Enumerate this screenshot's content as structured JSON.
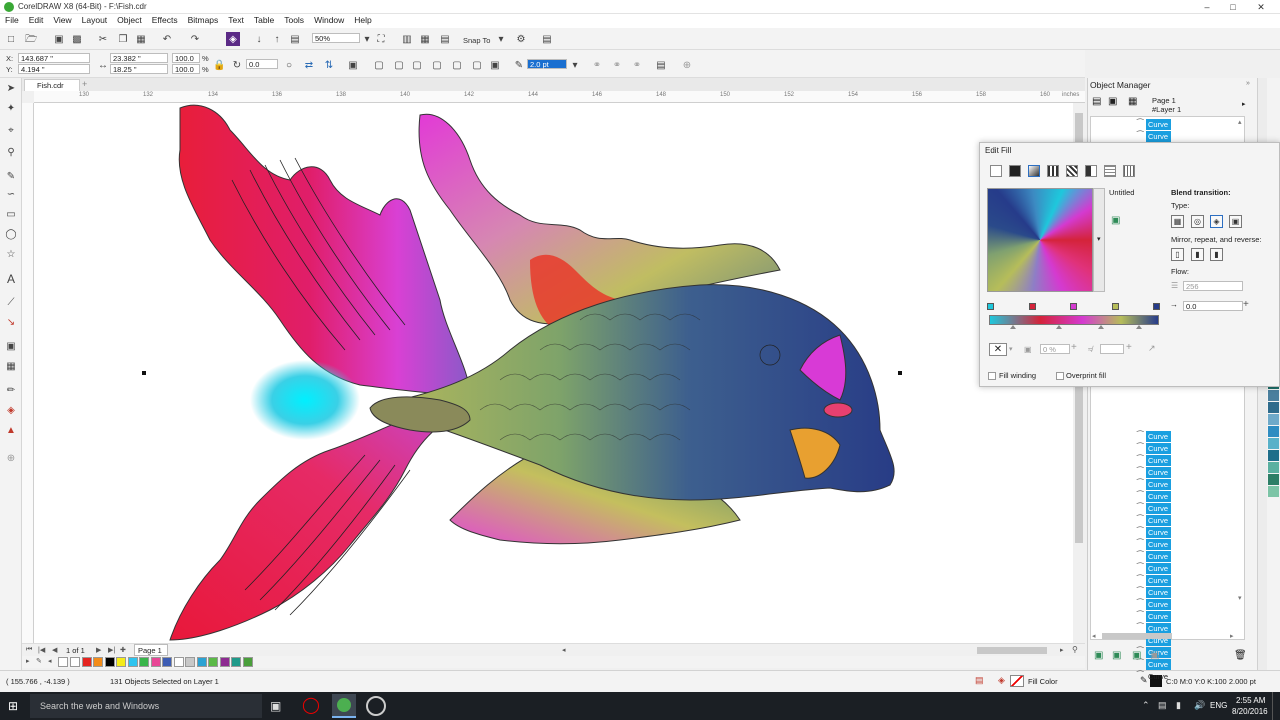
{
  "window": {
    "title": "CorelDRAW X8 (64-Bit) - F:\\Fish.cdr",
    "controls": [
      "–",
      "□",
      "✕"
    ]
  },
  "menu": [
    "File",
    "Edit",
    "View",
    "Layout",
    "Object",
    "Effects",
    "Bitmaps",
    "Text",
    "Table",
    "Tools",
    "Window",
    "Help"
  ],
  "toolbar": {
    "zoom_value": "50%",
    "snap_to_label": "Snap To"
  },
  "property_bar": {
    "x_label": "X:",
    "x_value": "143.687 \"",
    "y_label": "Y:",
    "y_value": "4.194 \"",
    "width_value": "23.382 \"",
    "height_value": "18.25 \"",
    "scale_w": "100.0",
    "scale_h": "100.0",
    "percent": "%",
    "rotation": "0.0",
    "outline_width": "2.0 pt"
  },
  "document": {
    "tab_label": "Fish.cdr",
    "ruler_unit": "inches",
    "ruler_ticks": [
      "130",
      "132",
      "134",
      "136",
      "138",
      "140",
      "142",
      "144",
      "146",
      "148",
      "150",
      "152",
      "154",
      "156",
      "158",
      "160"
    ],
    "page_nav": "1 of 1",
    "page_tab": "Page 1"
  },
  "object_manager": {
    "title": "Object Manager",
    "page_label": "Page 1",
    "layer_label": "#Layer 1",
    "curve_label": "Curve",
    "last_curve_label": "Curve",
    "top_rows": 2,
    "bottom_rows": 20
  },
  "edit_fill": {
    "title": "Edit Fill",
    "preset_name": "Untitled",
    "blend_transition_label": "Blend transition:",
    "type_label": "Type:",
    "mirror_label": "Mirror, repeat, and reverse:",
    "flow_label": "Flow:",
    "flow_value": "256",
    "angle_value": "0.0",
    "node_percent": "0 %",
    "fill_winding_label": "Fill winding",
    "overprint_label": "Overprint fill",
    "nodes": [
      {
        "color": "#1ec8dc"
      },
      {
        "color": "#d4233a"
      },
      {
        "color": "#d43ad0"
      },
      {
        "color": "#b6bd5a"
      },
      {
        "color": "#263b8a"
      }
    ]
  },
  "status": {
    "coords": "( 155.766 , -4.139 )",
    "selection": "131 Objects Selected on Layer 1",
    "fill_label": "Fill Color",
    "outline_info": "C:0 M:0 Y:0 K:100  2.000 pt"
  },
  "taskbar": {
    "search_placeholder": "Search the web and Windows",
    "time": "2:55 AM",
    "date": "8/20/2016",
    "lang": "ENG"
  },
  "palette_colors": [
    "#ffffff",
    "#e52420",
    "#f28c1a",
    "#000000",
    "#f5ec1b",
    "#2ec4ef",
    "#38b54a",
    "#e84796",
    "#3d5db4",
    "#ffffff",
    "#c8c8c8",
    "#2ba2d3",
    "#5bb947",
    "#8d2b91",
    "#1f9a8a",
    "#4a9e3b"
  ],
  "side_colors": [
    "#1d6f6a",
    "#4a7f9e",
    "#2e6b8c",
    "#6ea9c9",
    "#2e8cc1",
    "#58b1c9",
    "#1e6e8a",
    "#5ab0a0",
    "#2d7f67",
    "#7cc4a6"
  ]
}
